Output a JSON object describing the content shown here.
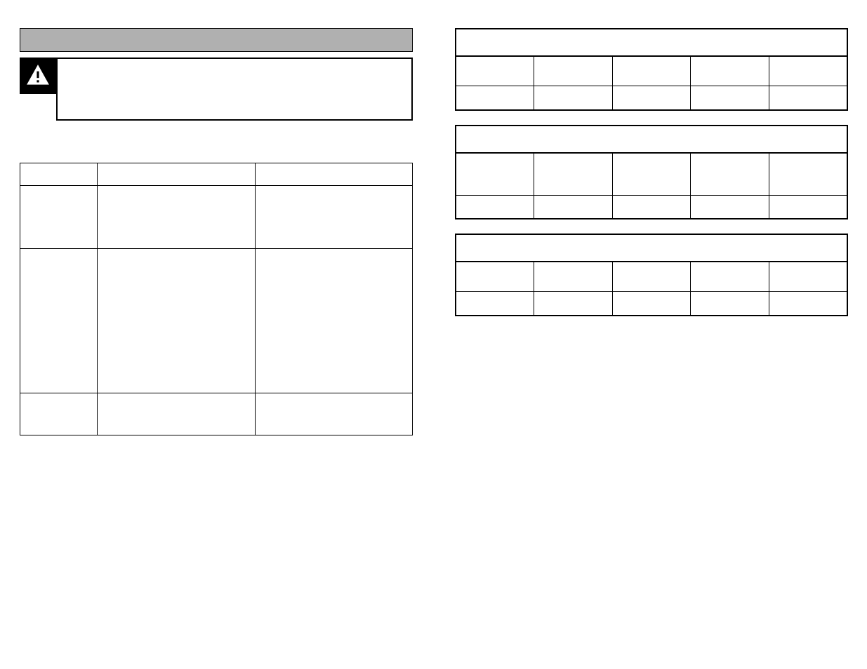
{
  "left": {
    "section_header": "",
    "warning": {
      "icon_alt": "warning-triangle",
      "text": ""
    },
    "main_table": {
      "headers": [
        "",
        "",
        ""
      ],
      "rows": [
        {
          "c1": "",
          "c2": "",
          "c3": ""
        },
        {
          "c1": "",
          "c2": "",
          "c3": ""
        },
        {
          "c1": "",
          "c2": "",
          "c3": ""
        }
      ]
    }
  },
  "right": {
    "blocks": [
      {
        "title": "",
        "headers": [
          "",
          "",
          "",
          "",
          ""
        ],
        "row": [
          "",
          "",
          "",
          "",
          ""
        ]
      },
      {
        "title": "",
        "headers": [
          "",
          "",
          "",
          "",
          ""
        ],
        "row": [
          "",
          "",
          "",
          "",
          ""
        ]
      },
      {
        "title": "",
        "headers": [
          "",
          "",
          "",
          "",
          ""
        ],
        "row": [
          "",
          "",
          "",
          "",
          ""
        ]
      }
    ]
  },
  "chart_data": {
    "type": "table",
    "description": "Document page with one 3-column/3-row table on the left and three 5-column/1-row tables on the right. All cells are blank in the visible page.",
    "tables": [
      {
        "name": "left-main-table",
        "columns": 3,
        "rows": 3,
        "headers": [
          "",
          "",
          ""
        ],
        "data": [
          [
            "",
            "",
            ""
          ],
          [
            "",
            "",
            ""
          ],
          [
            "",
            "",
            ""
          ]
        ]
      },
      {
        "name": "right-table-1",
        "columns": 5,
        "rows": 1,
        "title": "",
        "headers": [
          "",
          "",
          "",
          "",
          ""
        ],
        "data": [
          [
            "",
            "",
            "",
            "",
            ""
          ]
        ]
      },
      {
        "name": "right-table-2",
        "columns": 5,
        "rows": 1,
        "title": "",
        "headers": [
          "",
          "",
          "",
          "",
          ""
        ],
        "data": [
          [
            "",
            "",
            "",
            "",
            ""
          ]
        ]
      },
      {
        "name": "right-table-3",
        "columns": 5,
        "rows": 1,
        "title": "",
        "headers": [
          "",
          "",
          "",
          "",
          ""
        ],
        "data": [
          [
            "",
            "",
            "",
            "",
            ""
          ]
        ]
      }
    ]
  }
}
